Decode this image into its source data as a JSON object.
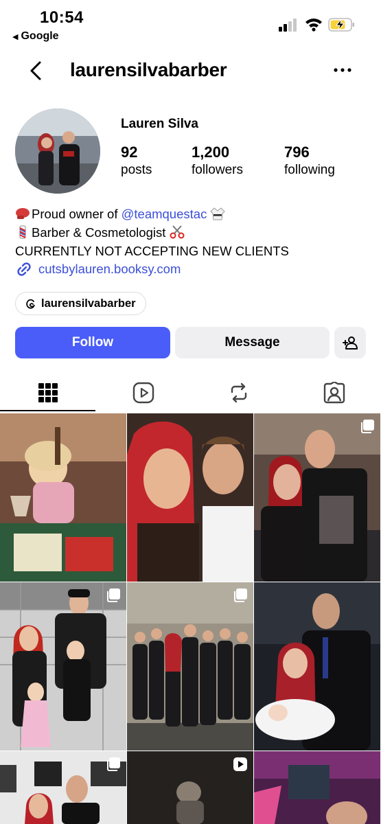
{
  "status_bar": {
    "time": "10:54",
    "back_app_label": "Google",
    "battery_color": "#f7d23c"
  },
  "nav": {
    "username": "laurensilvabarber",
    "back_icon": "chevron-left-icon",
    "more_icon": "ellipsis-icon"
  },
  "profile": {
    "full_name": "Lauren Silva",
    "stats": [
      {
        "value": "92",
        "label": "posts"
      },
      {
        "value": "1,200",
        "label": "followers"
      },
      {
        "value": "796",
        "label": "following"
      }
    ]
  },
  "bio": {
    "line1_prefix": "Proud owner of ",
    "line1_mention": "@teamquestac",
    "line2": "Barber & Cosmetologist",
    "line3": "CURRENTLY NOT ACCEPTING NEW CLIENTS",
    "link": "cutsbylauren.booksy.com",
    "threads_handle": "laurensilvabarber"
  },
  "actions": {
    "follow_label": "Follow",
    "message_label": "Message",
    "follow_color": "#4a5df9"
  },
  "tabs": [
    {
      "icon": "grid-icon",
      "active": true
    },
    {
      "icon": "reels-icon",
      "active": false
    },
    {
      "icon": "reposts-icon",
      "active": false
    },
    {
      "icon": "tagged-icon",
      "active": false
    }
  ],
  "posts": [
    {
      "type": "photo",
      "badge": ""
    },
    {
      "type": "photo",
      "badge": ""
    },
    {
      "type": "carousel",
      "badge": "carousel-icon"
    },
    {
      "type": "carousel",
      "badge": "carousel-icon"
    },
    {
      "type": "carousel",
      "badge": "carousel-icon"
    },
    {
      "type": "photo",
      "badge": ""
    },
    {
      "type": "carousel",
      "badge": "carousel-icon"
    },
    {
      "type": "video",
      "badge": "play-icon"
    },
    {
      "type": "photo",
      "badge": ""
    }
  ]
}
